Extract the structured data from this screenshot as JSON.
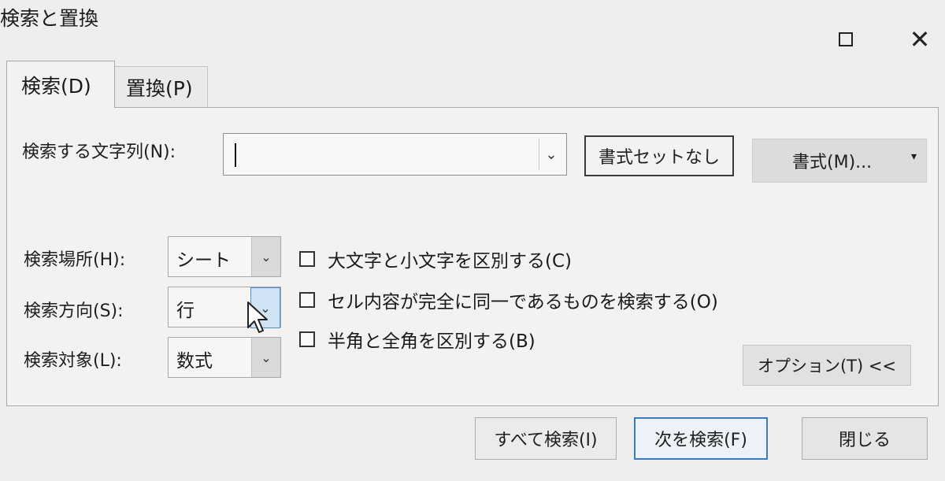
{
  "window": {
    "title": "検索と置換",
    "maximize_label": "",
    "close_label": "✕"
  },
  "tabs": [
    {
      "label": "検索(D)",
      "active": true
    },
    {
      "label": "置換(P)",
      "active": false
    }
  ],
  "find": {
    "label": "検索する文字列(N):",
    "value": "",
    "no_format_label": "書式セットなし",
    "format_label": "書式(M)...",
    "format_arrow": "▾",
    "combo_arrow": "⌄"
  },
  "options": {
    "within_label": "検索場所(H):",
    "within_value": "シート",
    "search_label": "検索方向(S):",
    "search_value": "行",
    "look_in_label": "検索対象(L):",
    "look_in_value": "数式",
    "arrow": "⌄"
  },
  "checkboxes": [
    {
      "label": "大文字と小文字を区別する(C)",
      "checked": false
    },
    {
      "label": "セル内容が完全に同一であるものを検索する(O)",
      "checked": false
    },
    {
      "label": "半角と全角を区別する(B)",
      "checked": false
    }
  ],
  "buttons": {
    "options_toggle": "オプション(T) <<",
    "find_all": "すべて検索(I)",
    "find_next": "次を検索(F)",
    "close": "閉じる"
  }
}
